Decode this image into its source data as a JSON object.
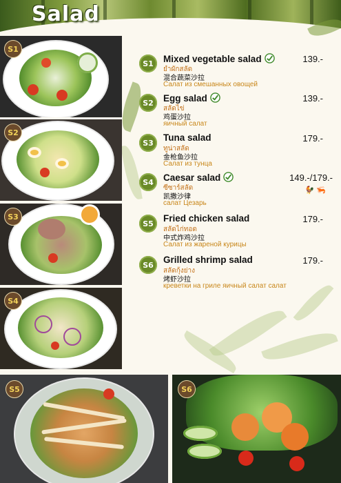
{
  "header": {
    "title": "Salad"
  },
  "photos": [
    {
      "badge": "S1",
      "name": "Mixed vegetable salad"
    },
    {
      "badge": "S2",
      "name": "Egg salad"
    },
    {
      "badge": "S3",
      "name": "Tuna salad"
    },
    {
      "badge": "S4",
      "name": "Caesar salad"
    },
    {
      "badge": "S5",
      "name": "Fried chicken salad"
    },
    {
      "badge": "S6",
      "name": "Grilled shrimp salad"
    }
  ],
  "items": [
    {
      "code": "S1",
      "name": "Mixed vegetable salad",
      "recommended": true,
      "price": "139.-",
      "thai": "ยำผักสลัด",
      "chinese": "混合蔬菜沙拉",
      "russian": "Салат из смешанных овощей"
    },
    {
      "code": "S2",
      "name": "Egg salad",
      "recommended": true,
      "price": "139.-",
      "thai": "สลัดไข่",
      "chinese": "鸡蛋沙拉",
      "russian": "яичный салат"
    },
    {
      "code": "S3",
      "name": "Tuna salad",
      "recommended": false,
      "price": "179.-",
      "thai": "ทูน่าสลัด",
      "chinese": "金枪鱼沙拉",
      "russian": "Салат из тунца"
    },
    {
      "code": "S4",
      "name": "Caesar salad",
      "recommended": true,
      "price": "149.-/179.-",
      "thai": "ซีซาร์สลัด",
      "chinese": "凯撒沙律",
      "russian": "салат Цезарь",
      "icons": [
        "chicken-icon",
        "shrimp-icon"
      ]
    },
    {
      "code": "S5",
      "name": "Fried chicken salad",
      "recommended": false,
      "price": "179.-",
      "thai": "สลัดไก่ทอด",
      "chinese": "中式炸鸡沙拉",
      "russian": "Салат из жареной курицы"
    },
    {
      "code": "S6",
      "name": "Grilled shrimp salad",
      "recommended": false,
      "price": "179.-",
      "thai": "สลัดกุ้งย่าง",
      "chinese": "烤虾沙拉",
      "russian": "креветки на гриле яичный салат салат"
    }
  ],
  "colors": {
    "accent": "#6a8a28",
    "russian_text": "#c88619",
    "thai_text": "#c4721a",
    "header_text": "#ffffff"
  }
}
